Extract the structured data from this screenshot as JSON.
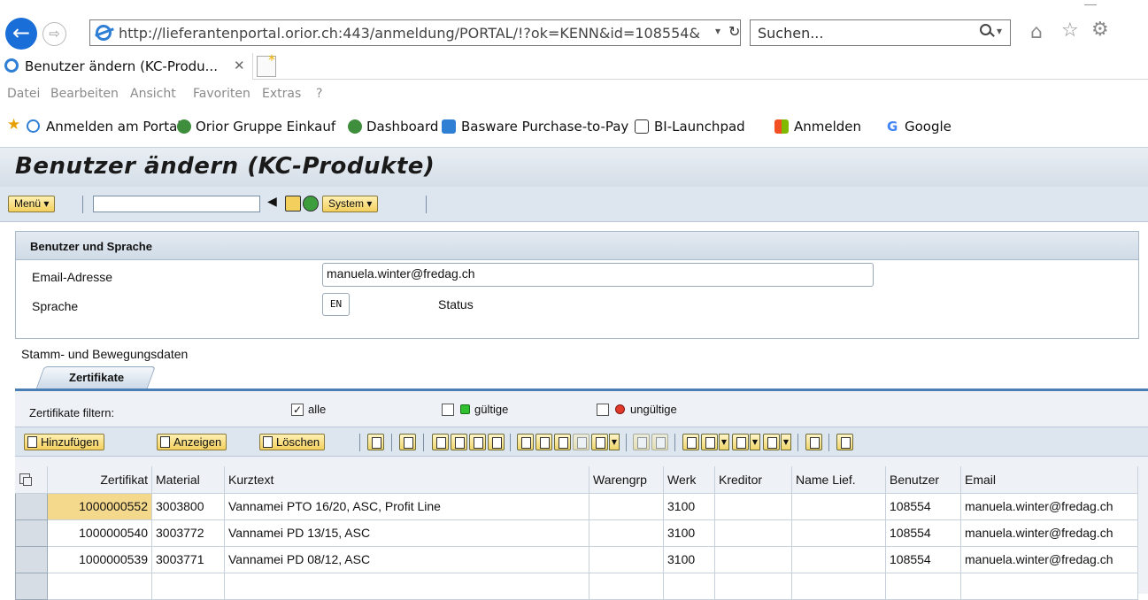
{
  "browser": {
    "url": "http://lieferantenportal.orior.ch:443/anmeldung/PORTAL/!?ok=KENN&id=108554&",
    "search_placeholder": "Suchen...",
    "tab_title": "Benutzer ändern (KC-Produ...",
    "menu": [
      "Datei",
      "Bearbeiten",
      "Ansicht",
      "Favoriten",
      "Extras",
      "?"
    ],
    "favorites": [
      "Anmelden am Portal",
      "Orior Gruppe Einkauf",
      "Dashboard",
      "Basware Purchase-to-Pay",
      "BI-Launchpad",
      "Anmelden",
      "Google"
    ]
  },
  "sap": {
    "title": "Benutzer ändern (KC-Produkte)",
    "toolbar": {
      "menu_label": "Menü",
      "system_label": "System"
    },
    "group": {
      "title": "Benutzer und Sprache",
      "email_label": "Email-Adresse",
      "email_value": "manuela.winter@fredag.ch",
      "language_label": "Sprache",
      "language_value": "EN",
      "status_label": "Status"
    },
    "section_label": "Stamm- und Bewegungsdaten",
    "tab_label": "Zertifikate",
    "filter": {
      "label": "Zertifikate filtern:",
      "all": "alle",
      "valid": "gültige",
      "invalid": "ungültige",
      "all_checked": true
    },
    "alv": {
      "add": "Hinzufügen",
      "show": "Anzeigen",
      "delete": "Löschen"
    },
    "table": {
      "columns": [
        "Zertifikat",
        "Material",
        "Kurztext",
        "Warengrp",
        "Werk",
        "Kreditor",
        "Name Lief.",
        "Benutzer",
        "Email"
      ],
      "rows": [
        {
          "zertifikat": "1000000552",
          "material": "3003800",
          "kurztext": "Vannamei PTO 16/20, ASC, Profit Line",
          "warengrp": "",
          "werk": "3100",
          "kreditor": "",
          "name": "",
          "benutzer": "108554",
          "email": "manuela.winter@fredag.ch"
        },
        {
          "zertifikat": "1000000540",
          "material": "3003772",
          "kurztext": "Vannamei PD 13/15, ASC",
          "warengrp": "",
          "werk": "3100",
          "kreditor": "",
          "name": "",
          "benutzer": "108554",
          "email": "manuela.winter@fredag.ch"
        },
        {
          "zertifikat": "1000000539",
          "material": "3003771",
          "kurztext": "Vannamei PD 08/12, ASC",
          "warengrp": "",
          "werk": "3100",
          "kreditor": "",
          "name": "",
          "benutzer": "108554",
          "email": "manuela.winter@fredag.ch"
        }
      ]
    }
  },
  "colors": {
    "sap_header": "#dde6ef",
    "highlight": "#f4d88c",
    "accent": "#4a7fb5"
  }
}
